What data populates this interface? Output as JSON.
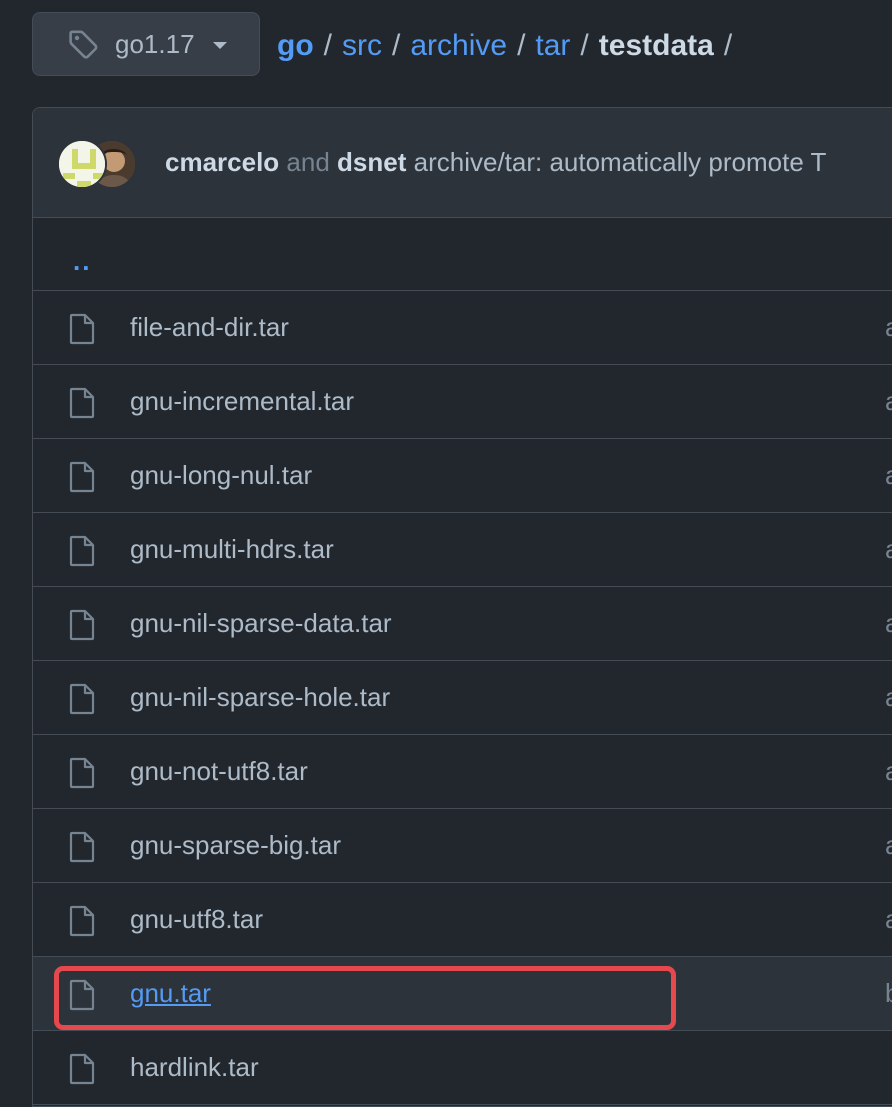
{
  "branch": {
    "label": "go1.17",
    "icon": "tag-icon"
  },
  "breadcrumb": {
    "root": "go",
    "parts": [
      "src",
      "archive",
      "tar"
    ],
    "current": "testdata",
    "separator": "/"
  },
  "commit": {
    "author1": "cmarcelo",
    "conjunction": "and",
    "author2": "dsnet",
    "message": "archive/tar: automatically promote T"
  },
  "listing": {
    "parent": "..",
    "files": [
      {
        "name": "file-and-dir.tar",
        "tail": "a"
      },
      {
        "name": "gnu-incremental.tar",
        "tail": "a"
      },
      {
        "name": "gnu-long-nul.tar",
        "tail": "a"
      },
      {
        "name": "gnu-multi-hdrs.tar",
        "tail": "a"
      },
      {
        "name": "gnu-nil-sparse-data.tar",
        "tail": "a"
      },
      {
        "name": "gnu-nil-sparse-hole.tar",
        "tail": "a"
      },
      {
        "name": "gnu-not-utf8.tar",
        "tail": "a"
      },
      {
        "name": "gnu-sparse-big.tar",
        "tail": "a"
      },
      {
        "name": "gnu-utf8.tar",
        "tail": "a"
      },
      {
        "name": "gnu.tar",
        "tail": "b"
      },
      {
        "name": "hardlink.tar",
        "tail": ""
      }
    ]
  },
  "colors": {
    "accent": "#539bf5",
    "highlight": "#e5484d",
    "background": "#22272e"
  }
}
